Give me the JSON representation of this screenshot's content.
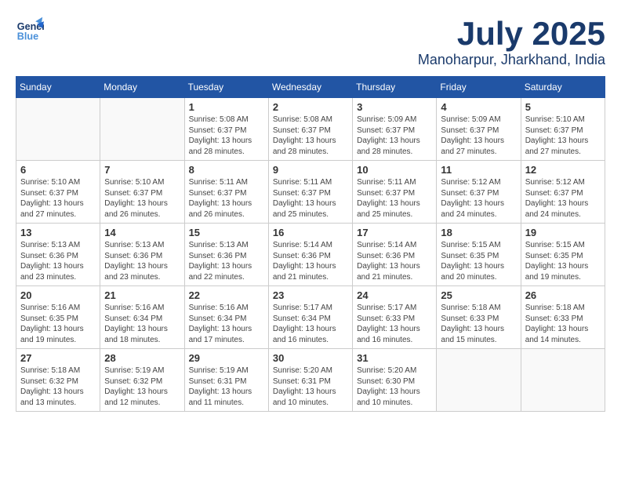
{
  "header": {
    "logo_line1": "General",
    "logo_line2": "Blue",
    "month": "July 2025",
    "location": "Manoharpur, Jharkhand, India"
  },
  "weekdays": [
    "Sunday",
    "Monday",
    "Tuesday",
    "Wednesday",
    "Thursday",
    "Friday",
    "Saturday"
  ],
  "weeks": [
    [
      {
        "day": "",
        "info": ""
      },
      {
        "day": "",
        "info": ""
      },
      {
        "day": "1",
        "info": "Sunrise: 5:08 AM\nSunset: 6:37 PM\nDaylight: 13 hours\nand 28 minutes."
      },
      {
        "day": "2",
        "info": "Sunrise: 5:08 AM\nSunset: 6:37 PM\nDaylight: 13 hours\nand 28 minutes."
      },
      {
        "day": "3",
        "info": "Sunrise: 5:09 AM\nSunset: 6:37 PM\nDaylight: 13 hours\nand 28 minutes."
      },
      {
        "day": "4",
        "info": "Sunrise: 5:09 AM\nSunset: 6:37 PM\nDaylight: 13 hours\nand 27 minutes."
      },
      {
        "day": "5",
        "info": "Sunrise: 5:10 AM\nSunset: 6:37 PM\nDaylight: 13 hours\nand 27 minutes."
      }
    ],
    [
      {
        "day": "6",
        "info": "Sunrise: 5:10 AM\nSunset: 6:37 PM\nDaylight: 13 hours\nand 27 minutes."
      },
      {
        "day": "7",
        "info": "Sunrise: 5:10 AM\nSunset: 6:37 PM\nDaylight: 13 hours\nand 26 minutes."
      },
      {
        "day": "8",
        "info": "Sunrise: 5:11 AM\nSunset: 6:37 PM\nDaylight: 13 hours\nand 26 minutes."
      },
      {
        "day": "9",
        "info": "Sunrise: 5:11 AM\nSunset: 6:37 PM\nDaylight: 13 hours\nand 25 minutes."
      },
      {
        "day": "10",
        "info": "Sunrise: 5:11 AM\nSunset: 6:37 PM\nDaylight: 13 hours\nand 25 minutes."
      },
      {
        "day": "11",
        "info": "Sunrise: 5:12 AM\nSunset: 6:37 PM\nDaylight: 13 hours\nand 24 minutes."
      },
      {
        "day": "12",
        "info": "Sunrise: 5:12 AM\nSunset: 6:37 PM\nDaylight: 13 hours\nand 24 minutes."
      }
    ],
    [
      {
        "day": "13",
        "info": "Sunrise: 5:13 AM\nSunset: 6:36 PM\nDaylight: 13 hours\nand 23 minutes."
      },
      {
        "day": "14",
        "info": "Sunrise: 5:13 AM\nSunset: 6:36 PM\nDaylight: 13 hours\nand 23 minutes."
      },
      {
        "day": "15",
        "info": "Sunrise: 5:13 AM\nSunset: 6:36 PM\nDaylight: 13 hours\nand 22 minutes."
      },
      {
        "day": "16",
        "info": "Sunrise: 5:14 AM\nSunset: 6:36 PM\nDaylight: 13 hours\nand 21 minutes."
      },
      {
        "day": "17",
        "info": "Sunrise: 5:14 AM\nSunset: 6:36 PM\nDaylight: 13 hours\nand 21 minutes."
      },
      {
        "day": "18",
        "info": "Sunrise: 5:15 AM\nSunset: 6:35 PM\nDaylight: 13 hours\nand 20 minutes."
      },
      {
        "day": "19",
        "info": "Sunrise: 5:15 AM\nSunset: 6:35 PM\nDaylight: 13 hours\nand 19 minutes."
      }
    ],
    [
      {
        "day": "20",
        "info": "Sunrise: 5:16 AM\nSunset: 6:35 PM\nDaylight: 13 hours\nand 19 minutes."
      },
      {
        "day": "21",
        "info": "Sunrise: 5:16 AM\nSunset: 6:34 PM\nDaylight: 13 hours\nand 18 minutes."
      },
      {
        "day": "22",
        "info": "Sunrise: 5:16 AM\nSunset: 6:34 PM\nDaylight: 13 hours\nand 17 minutes."
      },
      {
        "day": "23",
        "info": "Sunrise: 5:17 AM\nSunset: 6:34 PM\nDaylight: 13 hours\nand 16 minutes."
      },
      {
        "day": "24",
        "info": "Sunrise: 5:17 AM\nSunset: 6:33 PM\nDaylight: 13 hours\nand 16 minutes."
      },
      {
        "day": "25",
        "info": "Sunrise: 5:18 AM\nSunset: 6:33 PM\nDaylight: 13 hours\nand 15 minutes."
      },
      {
        "day": "26",
        "info": "Sunrise: 5:18 AM\nSunset: 6:33 PM\nDaylight: 13 hours\nand 14 minutes."
      }
    ],
    [
      {
        "day": "27",
        "info": "Sunrise: 5:18 AM\nSunset: 6:32 PM\nDaylight: 13 hours\nand 13 minutes."
      },
      {
        "day": "28",
        "info": "Sunrise: 5:19 AM\nSunset: 6:32 PM\nDaylight: 13 hours\nand 12 minutes."
      },
      {
        "day": "29",
        "info": "Sunrise: 5:19 AM\nSunset: 6:31 PM\nDaylight: 13 hours\nand 11 minutes."
      },
      {
        "day": "30",
        "info": "Sunrise: 5:20 AM\nSunset: 6:31 PM\nDaylight: 13 hours\nand 10 minutes."
      },
      {
        "day": "31",
        "info": "Sunrise: 5:20 AM\nSunset: 6:30 PM\nDaylight: 13 hours\nand 10 minutes."
      },
      {
        "day": "",
        "info": ""
      },
      {
        "day": "",
        "info": ""
      }
    ]
  ]
}
